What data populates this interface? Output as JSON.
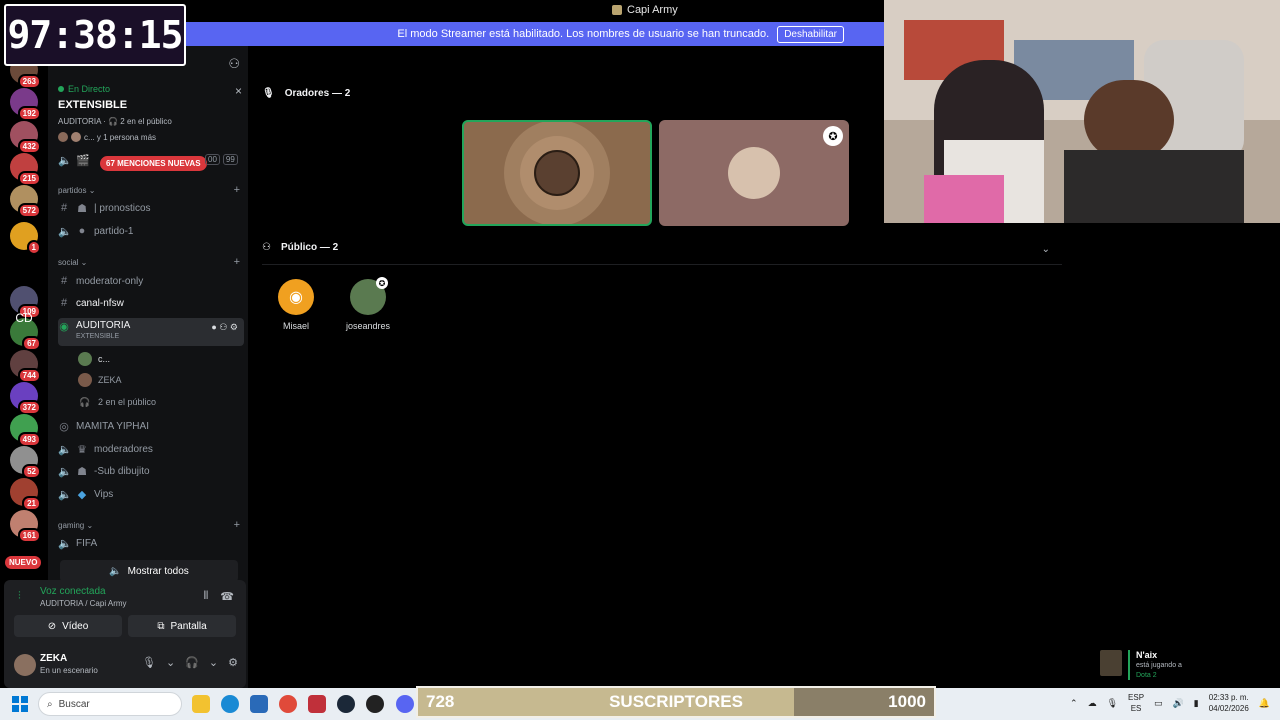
{
  "window": {
    "title": "Capi Army"
  },
  "streamer_banner": {
    "text": "El modo Streamer está habilitado. Los nombres de usuario se han truncado.",
    "button": "Deshabilitar"
  },
  "timer": {
    "value": "97:38:15"
  },
  "rail": {
    "servers": [
      {
        "badge": "263",
        "color": "#6b4a3a"
      },
      {
        "badge": "192",
        "color": "#7a3a8a"
      },
      {
        "badge": "432",
        "color": "#a05060"
      },
      {
        "badge": "215",
        "color": "#c04040"
      },
      {
        "badge": "572",
        "color": "#b09060"
      },
      {
        "badge": "1",
        "color": "#e0a020"
      },
      {
        "badge": "109",
        "color": "#505070"
      },
      {
        "badge": "67",
        "color": "#3a7a3a"
      },
      {
        "badge": "744",
        "color": "#604040"
      },
      {
        "badge": "372",
        "color": "#6a40c0"
      },
      {
        "badge": "493",
        "color": "#40a050"
      },
      {
        "badge": "52",
        "color": "#909090"
      },
      {
        "badge": "21",
        "color": "#a04030"
      },
      {
        "badge": "161",
        "color": "#c08070"
      }
    ],
    "cd_label": "CD",
    "new_label": "NUEVO"
  },
  "sidebar": {
    "live": {
      "tag": "En Directo",
      "name": "EXTENSIBLE",
      "sub": "AUDITORIA · 🎧 2 en el público",
      "people": "c... y 1 persona más"
    },
    "mentions": "67 MENCIONES NUEVAS",
    "counts": [
      "00",
      "99"
    ],
    "categories": {
      "partidos": "partidos",
      "social": "social",
      "gaming": "gaming"
    },
    "channels": {
      "pronosticos": "| pronosticos",
      "partido1": "partido-1",
      "moderator_only": "moderator-only",
      "canal_nfsw": "canal-nfsw",
      "auditoria": "AUDITORIA",
      "auditoria_sub": "EXTENSIBLE",
      "mamita": "MAMITA YIPHAI",
      "moderadores": "moderadores",
      "sub_dibujito": "-Sub dibujito",
      "vips": "Vips",
      "fifa": "FIFA"
    },
    "members": {
      "m1": "c...",
      "m2": "ZEKA",
      "audience": "2 en el público"
    },
    "show_all": "Mostrar todos"
  },
  "voice": {
    "status": "Voz conectada",
    "where": "AUDITORIA / Capi Army",
    "video": "Vídeo",
    "screen": "Pantalla"
  },
  "user": {
    "name": "ZEKA",
    "status": "En un escenario"
  },
  "stage": {
    "speakers_header": "Oradores — 2",
    "audience_header": "Público — 2",
    "audience": [
      {
        "name": "Misael",
        "color": "#f0a020"
      },
      {
        "name": "joseandres",
        "color": "#5a7a50"
      }
    ]
  },
  "notification": {
    "name": "N'aix",
    "line": "está jugando a",
    "game": "Dota 2"
  },
  "taskbar": {
    "search": "Buscar",
    "lang_top": "ESP",
    "lang_bottom": "ES",
    "time": "02:33 p. m.",
    "date": "04/02/2026"
  },
  "subscribers": {
    "current": "728",
    "label": "SUSCRIPTORES",
    "goal": "1000",
    "progress": 0.728
  }
}
